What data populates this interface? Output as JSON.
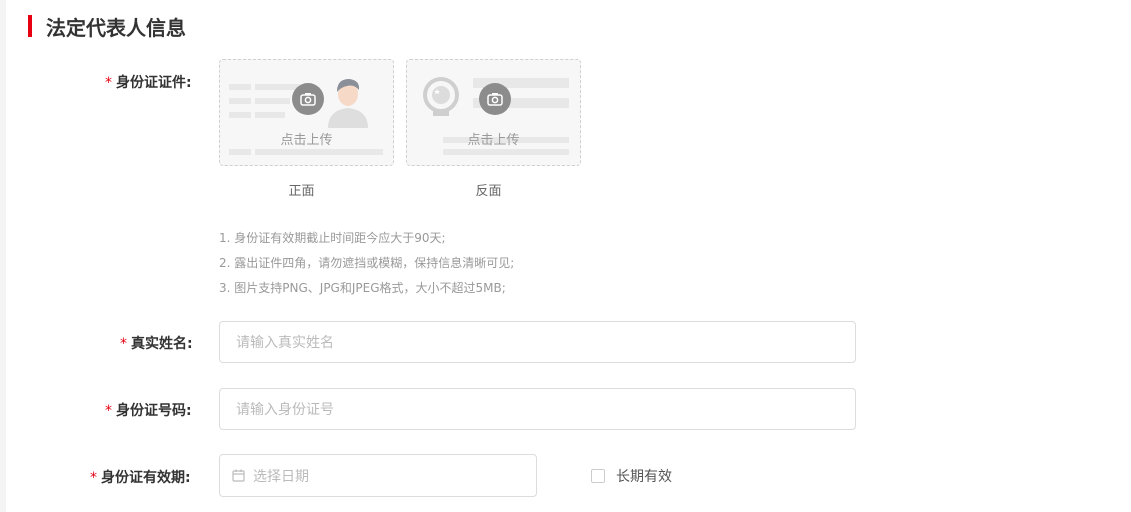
{
  "section": {
    "title": "法定代表人信息"
  },
  "id_card": {
    "label": "身份证证件:",
    "front": {
      "upload_text": "点击上传",
      "caption": "正面"
    },
    "back": {
      "upload_text": "点击上传",
      "caption": "反面"
    },
    "notes": [
      "1. 身份证有效期截止时间距今应大于90天;",
      "2. 露出证件四角，请勿遮挡或模糊，保持信息清晰可见;",
      "3. 图片支持PNG、JPG和JPEG格式，大小不超过5MB;"
    ]
  },
  "real_name": {
    "label": "真实姓名:",
    "placeholder": "请输入真实姓名"
  },
  "id_number": {
    "label": "身份证号码:",
    "placeholder": "请输入身份证号"
  },
  "id_validity": {
    "label": "身份证有效期:",
    "placeholder": "选择日期",
    "long_term_label": "长期有效",
    "long_term_checked": false
  },
  "colors": {
    "accent": "#e60012"
  }
}
